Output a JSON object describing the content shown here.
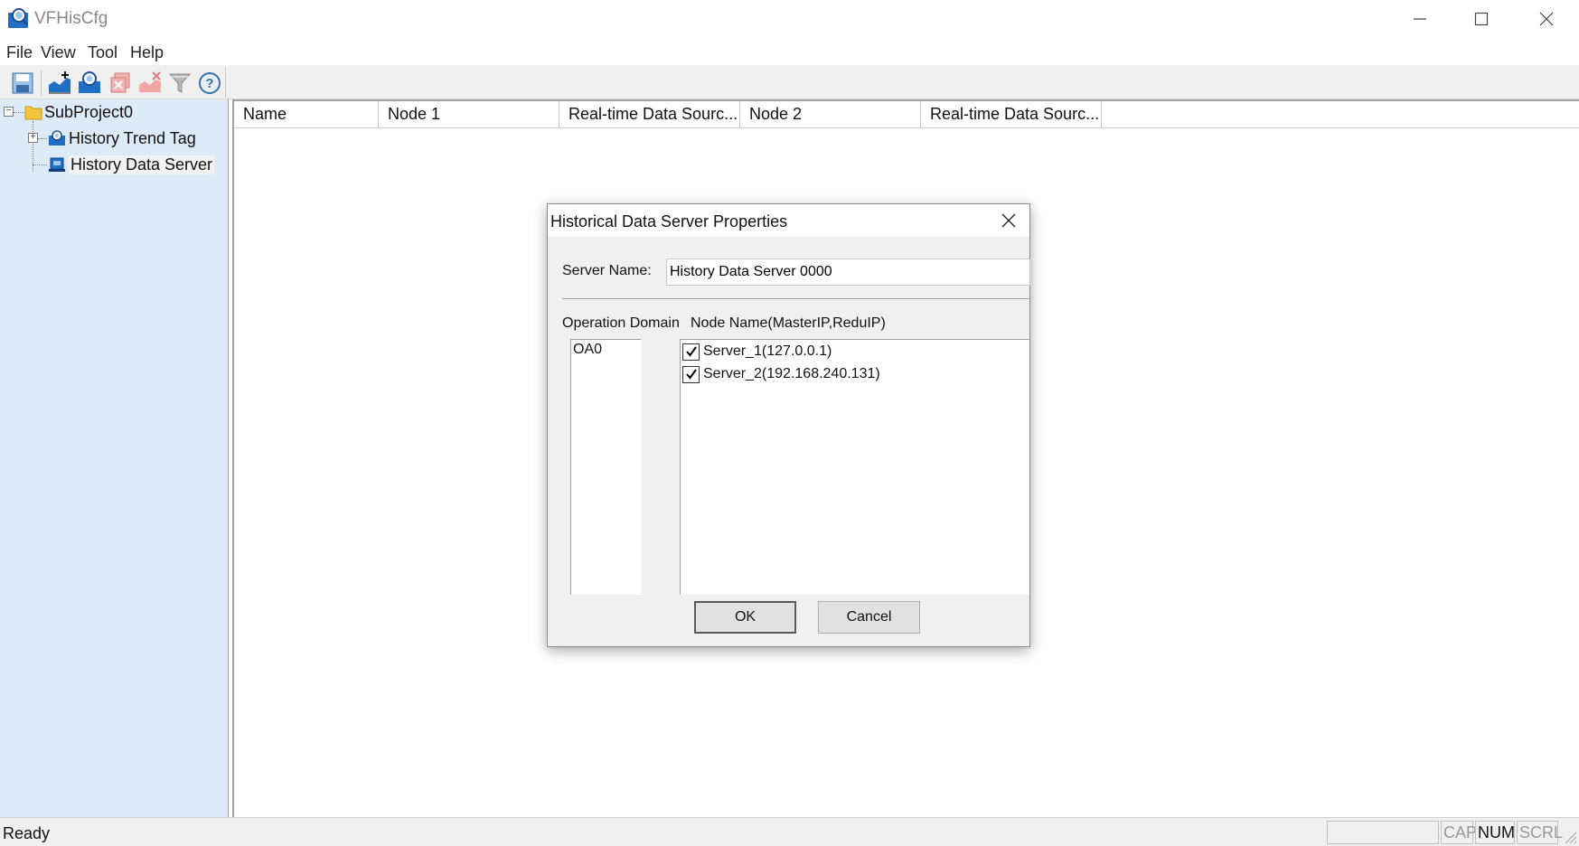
{
  "window": {
    "title": "VFHisCfg",
    "controls": {
      "minimize": "minimize-icon",
      "maximize": "maximize-icon",
      "close": "close-icon"
    }
  },
  "menu": {
    "items": [
      {
        "label": "File"
      },
      {
        "label": "View"
      },
      {
        "label": "Tool"
      },
      {
        "label": "Help"
      }
    ]
  },
  "toolbar": {
    "buttons": [
      {
        "icon": "save-icon"
      },
      {
        "icon": "add-tag-icon"
      },
      {
        "icon": "add-server-icon"
      },
      {
        "icon": "delete-icon"
      },
      {
        "icon": "delete-all-icon"
      },
      {
        "icon": "filter-icon"
      },
      {
        "icon": "help-icon"
      }
    ]
  },
  "tree": {
    "root": {
      "label": "SubProject0",
      "icon": "folder-icon"
    },
    "children": [
      {
        "label": "History Trend Tag",
        "icon": "trend-tag-icon"
      },
      {
        "label": "History Data Server",
        "icon": "data-server-icon",
        "selected": true
      }
    ]
  },
  "list": {
    "columns": [
      "Name",
      "Node 1",
      "Real-time Data Sourc...",
      "Node 2",
      "Real-time Data Sourc..."
    ]
  },
  "dialog": {
    "title": "Historical Data Server Properties",
    "server_name_label": "Server Name:",
    "server_name_value": "History Data Server 0000",
    "operation_domain_label": "Operation Domain",
    "node_name_label": "Node Name(MasterIP,ReduIP)",
    "domains": [
      "OA0"
    ],
    "nodes": [
      {
        "label": "Server_1(127.0.0.1)",
        "checked": true
      },
      {
        "label": "Server_2(192.168.240.131)",
        "checked": true
      }
    ],
    "ok_label": "OK",
    "cancel_label": "Cancel"
  },
  "status": {
    "text": "Ready",
    "panes": [
      "CAP",
      "NUM",
      "SCRL"
    ],
    "active_panes": [
      "NUM"
    ]
  },
  "colors": {
    "tree_bg": "#ddeaf8",
    "accent_blue": "#1f6fc5"
  }
}
